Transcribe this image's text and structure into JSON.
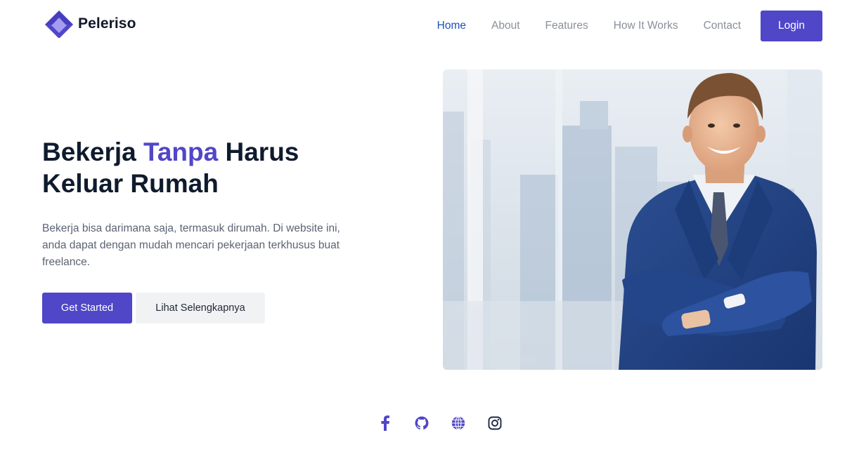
{
  "brand": {
    "name": "Peleriso",
    "accent": "#4f46c8"
  },
  "nav": {
    "items": [
      {
        "label": "Home",
        "active": true
      },
      {
        "label": "About",
        "active": false
      },
      {
        "label": "Features",
        "active": false
      },
      {
        "label": "How It Works",
        "active": false
      },
      {
        "label": "Contact",
        "active": false
      }
    ],
    "login_label": "Login"
  },
  "hero": {
    "title_part1": "Bekerja ",
    "title_accent": "Tanpa",
    "title_part2": " Harus",
    "title_line2": "Keluar Rumah",
    "description": "Bekerja bisa darimana saja, termasuk dirumah. Di website ini, anda dapat dengan mudah mencari pekerjaan terkhusus buat freelance.",
    "primary_button": "Get Started",
    "secondary_button": "Lihat Selengkapnya",
    "image_subject": "businessman-in-suit-arms-crossed"
  },
  "social": {
    "icons": [
      "facebook-icon",
      "github-icon",
      "globe-icon",
      "instagram-icon"
    ]
  }
}
